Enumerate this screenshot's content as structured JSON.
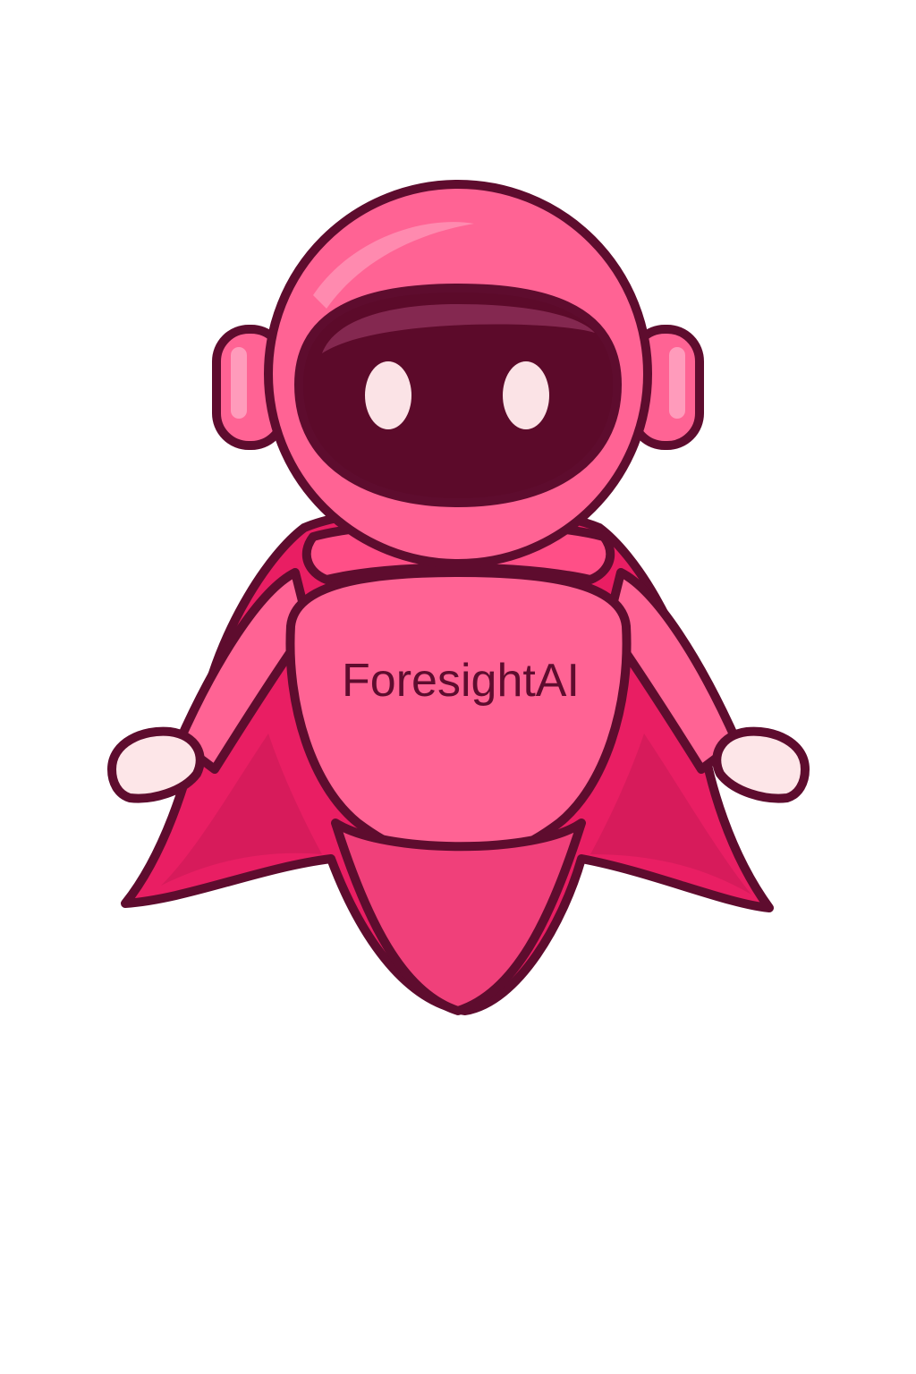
{
  "logo": {
    "label": "ForesightAI"
  },
  "colors": {
    "background": "#ffffff",
    "outline": "#5e0c2e",
    "pink_main": "#ff6394",
    "pink_light": "#ff86ac",
    "pink_cape": "#e91e63",
    "pink_cape_dark": "#c81a56",
    "visor": "#5c0a2a",
    "eyes": "#fbe3e6",
    "hands": "#fde6e8",
    "label_text": "#5e0c2e"
  },
  "icons": {
    "mascot": "robot-mascot-icon"
  }
}
